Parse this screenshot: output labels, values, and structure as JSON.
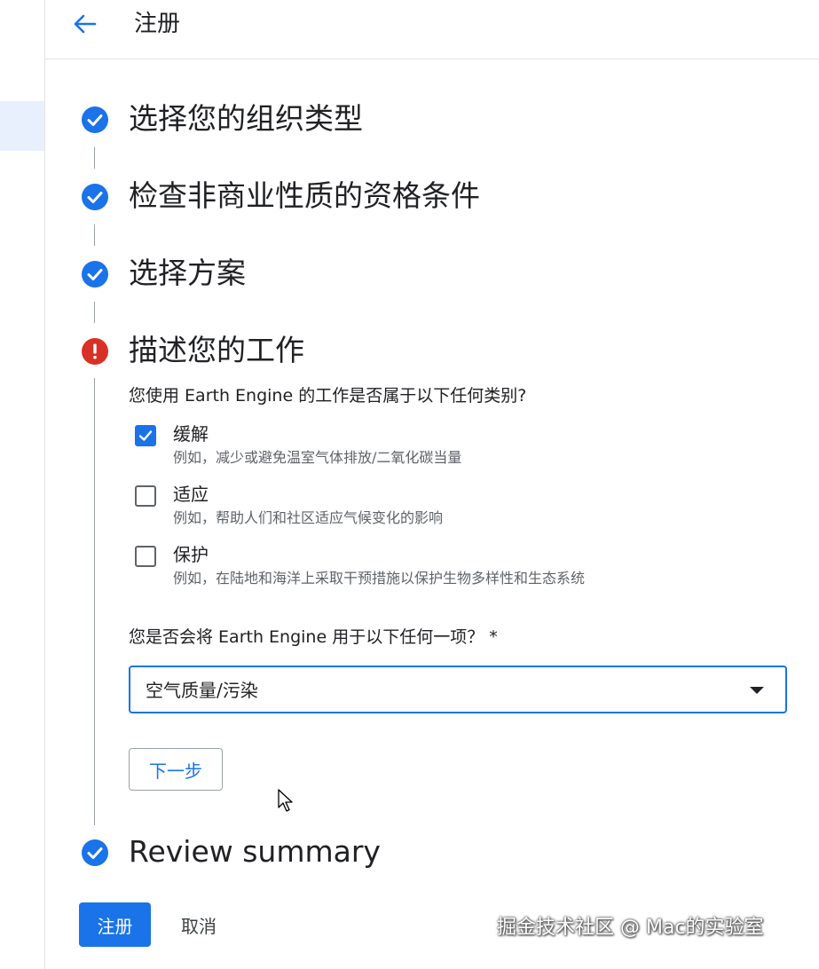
{
  "header": {
    "title": "注册",
    "back_icon": "arrow-back-icon"
  },
  "steps": [
    {
      "title": "选择您的组织类型",
      "status": "complete"
    },
    {
      "title": "检查非商业性质的资格条件",
      "status": "complete"
    },
    {
      "title": "选择方案",
      "status": "complete"
    },
    {
      "title": "描述您的工作",
      "status": "error"
    },
    {
      "title": "Review summary",
      "status": "complete"
    }
  ],
  "work": {
    "question1": "您使用 Earth Engine 的工作是否属于以下任何类别?",
    "options": [
      {
        "label": "缓解",
        "description": "例如，减少或避免温室气体排放/二氧化碳当量",
        "checked": true
      },
      {
        "label": "适应",
        "description": "例如，帮助人们和社区适应气候变化的影响",
        "checked": false
      },
      {
        "label": "保护",
        "description": "例如，在陆地和海洋上采取干预措施以保护生物多样性和生态系统",
        "checked": false
      }
    ],
    "question2": "您是否会将 Earth Engine 用于以下任何一项？ *",
    "select_value": "空气质量/污染",
    "next_label": "下一步"
  },
  "footer": {
    "register_label": "注册",
    "cancel_label": "取消"
  },
  "watermark": "掘金技术社区 @ Mac的实验室",
  "colors": {
    "accent": "#1a73e8",
    "error": "#d93025",
    "text": "#202124",
    "muted": "#5f6368"
  }
}
